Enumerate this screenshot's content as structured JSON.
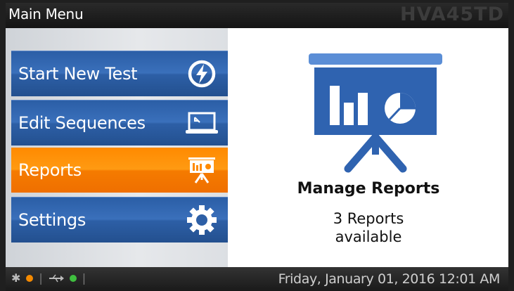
{
  "header": {
    "title": "Main Menu",
    "model": "HVA45TD"
  },
  "menu": {
    "items": [
      {
        "label": "Start New Test",
        "icon": "lightning-icon",
        "active": false
      },
      {
        "label": "Edit Sequences",
        "icon": "monitor-icon",
        "active": false
      },
      {
        "label": "Reports",
        "icon": "presentation-chart-icon",
        "active": true
      },
      {
        "label": "Settings",
        "icon": "gear-icon",
        "active": false
      }
    ]
  },
  "panel": {
    "title": "Manage Reports",
    "subtitle_line1": "3 Reports",
    "subtitle_line2": "available"
  },
  "status": {
    "bluetooth_status_color": "#f58a00",
    "usb_status_color": "#3fbf3f",
    "datetime": "Friday, January 01, 2016 12:01 AM"
  },
  "colors": {
    "menu_blue": "#2b5ea6",
    "menu_active": "#ff8a00",
    "icon_blue": "#2f63b0"
  }
}
